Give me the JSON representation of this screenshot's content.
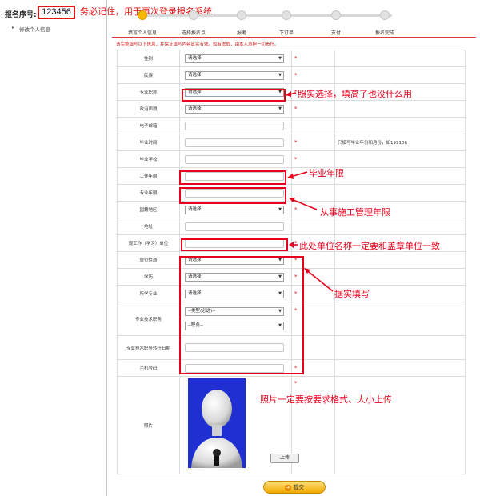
{
  "registration": {
    "label": "报名序号:",
    "number": "123456",
    "note": "务必记住，用于再次登录报名系统"
  },
  "sidebar": {
    "items": [
      {
        "label": "修改个人信息"
      }
    ]
  },
  "progress": {
    "steps": [
      {
        "label": "填写个人信息",
        "active": true
      },
      {
        "label": "选择报名点",
        "active": false
      },
      {
        "label": "报考",
        "active": false
      },
      {
        "label": "下订单",
        "active": false
      },
      {
        "label": "支付",
        "active": false
      },
      {
        "label": "报名完成",
        "active": false
      }
    ]
  },
  "instruction": "请完整填写以下信息，并保证填写内容真实有效。如有虚假，由本人承担一切责任。",
  "form": {
    "gender": {
      "label": "性别",
      "value": "请选择",
      "mark": "*"
    },
    "ethnicity": {
      "label": "民族",
      "value": "请选择",
      "mark": "*"
    },
    "major_title": {
      "label": "专业职称",
      "value": "请选择",
      "mark": "*"
    },
    "political_status": {
      "label": "政治面貌",
      "value": "请选择",
      "mark": "*"
    },
    "email": {
      "label": "电子邮箱",
      "value": "",
      "mark": ""
    },
    "graduation_time": {
      "label": "毕业时间",
      "value": "",
      "mark": "*",
      "hint": "只填写毕业年份和月份，如199106"
    },
    "graduation_school": {
      "label": "毕业学校",
      "value": "",
      "mark": "*"
    },
    "work_years": {
      "label": "工作年限",
      "value": "",
      "mark": ""
    },
    "major_years": {
      "label": "专业年限",
      "value": "",
      "mark": ""
    },
    "region": {
      "label": "国籍地区",
      "value": "请选择",
      "mark": "*"
    },
    "address": {
      "label": "地址",
      "value": "",
      "mark": ""
    },
    "employer": {
      "label": "现工作（学习）单位",
      "value": "",
      "mark": "*"
    },
    "unit_nature": {
      "label": "单位性质",
      "value": "请选择",
      "mark": "*"
    },
    "education": {
      "label": "学历",
      "value": "请选择",
      "mark": "*"
    },
    "major_studied": {
      "label": "所学专业",
      "value": "请选择",
      "mark": "*"
    },
    "tech_position": {
      "label": "专业技术职务",
      "category": "--类型(必选)--",
      "position": "--职务--",
      "mark": "*"
    },
    "tech_position_date": {
      "label": "专业技术职务转任日期",
      "value": "",
      "mark": ""
    },
    "phone": {
      "label": "手机号码",
      "value": "",
      "mark": "*"
    },
    "photo": {
      "label": "照片",
      "mark": "*",
      "upload_label": "上传"
    }
  },
  "submit": {
    "label": "提交"
  },
  "annotations": {
    "major_title": "照实选择，填高了也没什么用",
    "work_years": "毕业年限",
    "major_years": "从事施工管理年限",
    "employer": "此处单位名称一定要和盖章单位一致",
    "fill_truthfully": "据实填写",
    "photo": "照片一定要按要求格式、大小上传"
  },
  "colors": {
    "annotation": "#e8001c",
    "active_step": "#f5b800",
    "photo_background": "#1f2fd2"
  }
}
